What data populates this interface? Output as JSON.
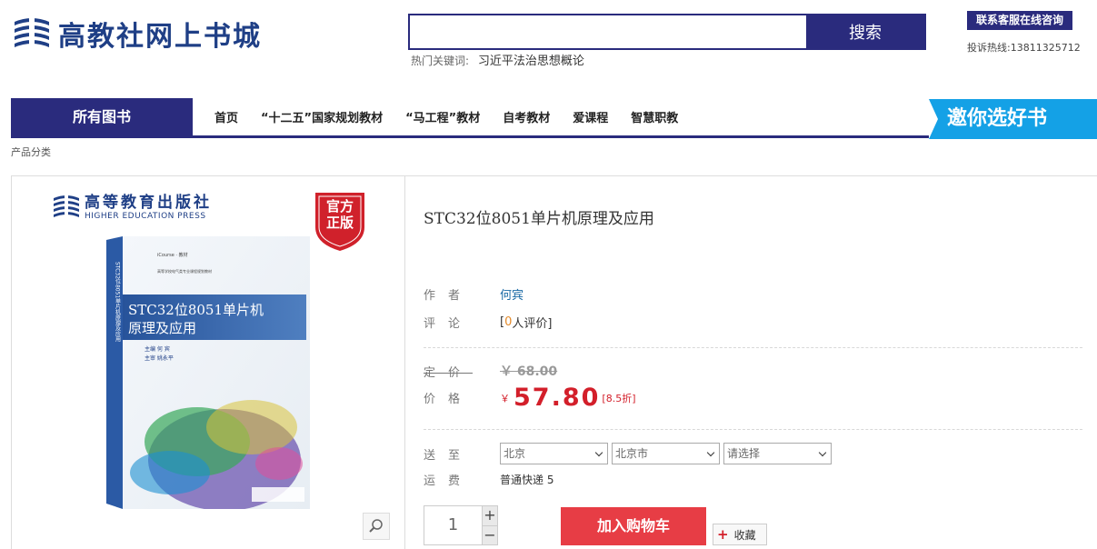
{
  "header": {
    "logo_text": "高教社网上书城",
    "search": {
      "placeholder": "",
      "button": "搜索"
    },
    "hotwords_label": "热门关键词:",
    "hotwords": [
      "习近平法治思想概论"
    ],
    "service_button": "联系客服在线咨询",
    "hotline": "投诉热线:13811325712"
  },
  "nav": {
    "all_books": "所有图书",
    "items": [
      "首页",
      "“十二五”国家规划教材",
      "“马工程”教材",
      "自考教材",
      "爱课程",
      "智慧职教"
    ],
    "invite": "邀你选好书"
  },
  "breadcrumb": "产品分类",
  "image_panel": {
    "press_cn": "高等教育出版社",
    "press_en": "HIGHER EDUCATION PRESS",
    "badge_lines": [
      "官方",
      "正版"
    ],
    "cover": {
      "title_line1": "STC32位8051单片机",
      "title_line2": "原理及应用",
      "editor": "主编  何  宾",
      "reviewer": "主审  姚永平",
      "spine": "STC32位8051单片机原理及应用",
      "top_small_1": "iCourse · 教材",
      "top_small_2": "高等学校电气类专业课程规划教材"
    }
  },
  "product": {
    "title": "STC32位8051单片机原理及应用",
    "author_label": "作者",
    "author": "何宾",
    "review_label": "评论",
    "review_open": "[",
    "review_count": "0",
    "review_suffix": "人评价]",
    "list_price_label": "定价",
    "list_price": "￥ 68.00",
    "price_label": "价格",
    "currency": "￥",
    "price": "57.80",
    "discount": "[8.5折]",
    "ship_label": "送至",
    "regions": [
      "北京",
      "北京市",
      "请选择"
    ],
    "freight_label": "运费",
    "shipping": "普通快递 5",
    "quantity": "1",
    "qty_plus": "+",
    "qty_minus": "−",
    "add_to_cart": "加入购物车",
    "favorite": "收藏"
  },
  "colors": {
    "brand_navy": "#2a2b7d",
    "invite_blue": "#14a1e6",
    "price_red": "#d31f2a",
    "cart_red": "#e73d45"
  }
}
